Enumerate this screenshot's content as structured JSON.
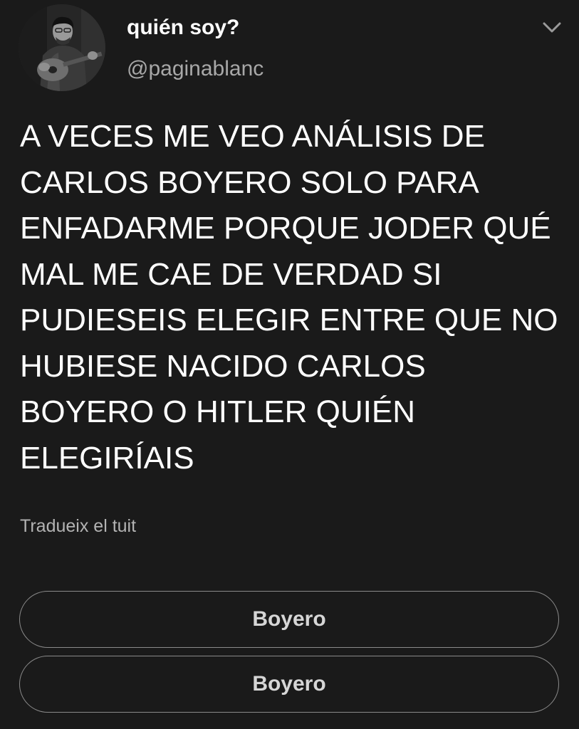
{
  "tweet": {
    "display_name": "quién soy?",
    "handle": "@paginablanc",
    "avatar_icon": "avatar-guitar-player-photo",
    "menu_icon": "chevron-down-icon",
    "text": "A VECES ME VEO ANÁLISIS DE CARLOS BOYERO SOLO PARA ENFADARME PORQUE JODER QUÉ MAL ME CAE DE VERDAD SI PUDIESEIS ELEGIR ENTRE QUE NO HUBIESE NACIDO CARLOS BOYERO O HITLER QUIÉN ELEGIRÍAIS",
    "translate_label": "Tradueix el tuit"
  },
  "poll": {
    "options": [
      {
        "label": "Boyero"
      },
      {
        "label": "Boyero"
      }
    ]
  },
  "colors": {
    "background": "#1a1a1a",
    "text": "#ffffff",
    "secondary_text": "#a8a8a8",
    "poll_border": "#8a8a8a"
  }
}
